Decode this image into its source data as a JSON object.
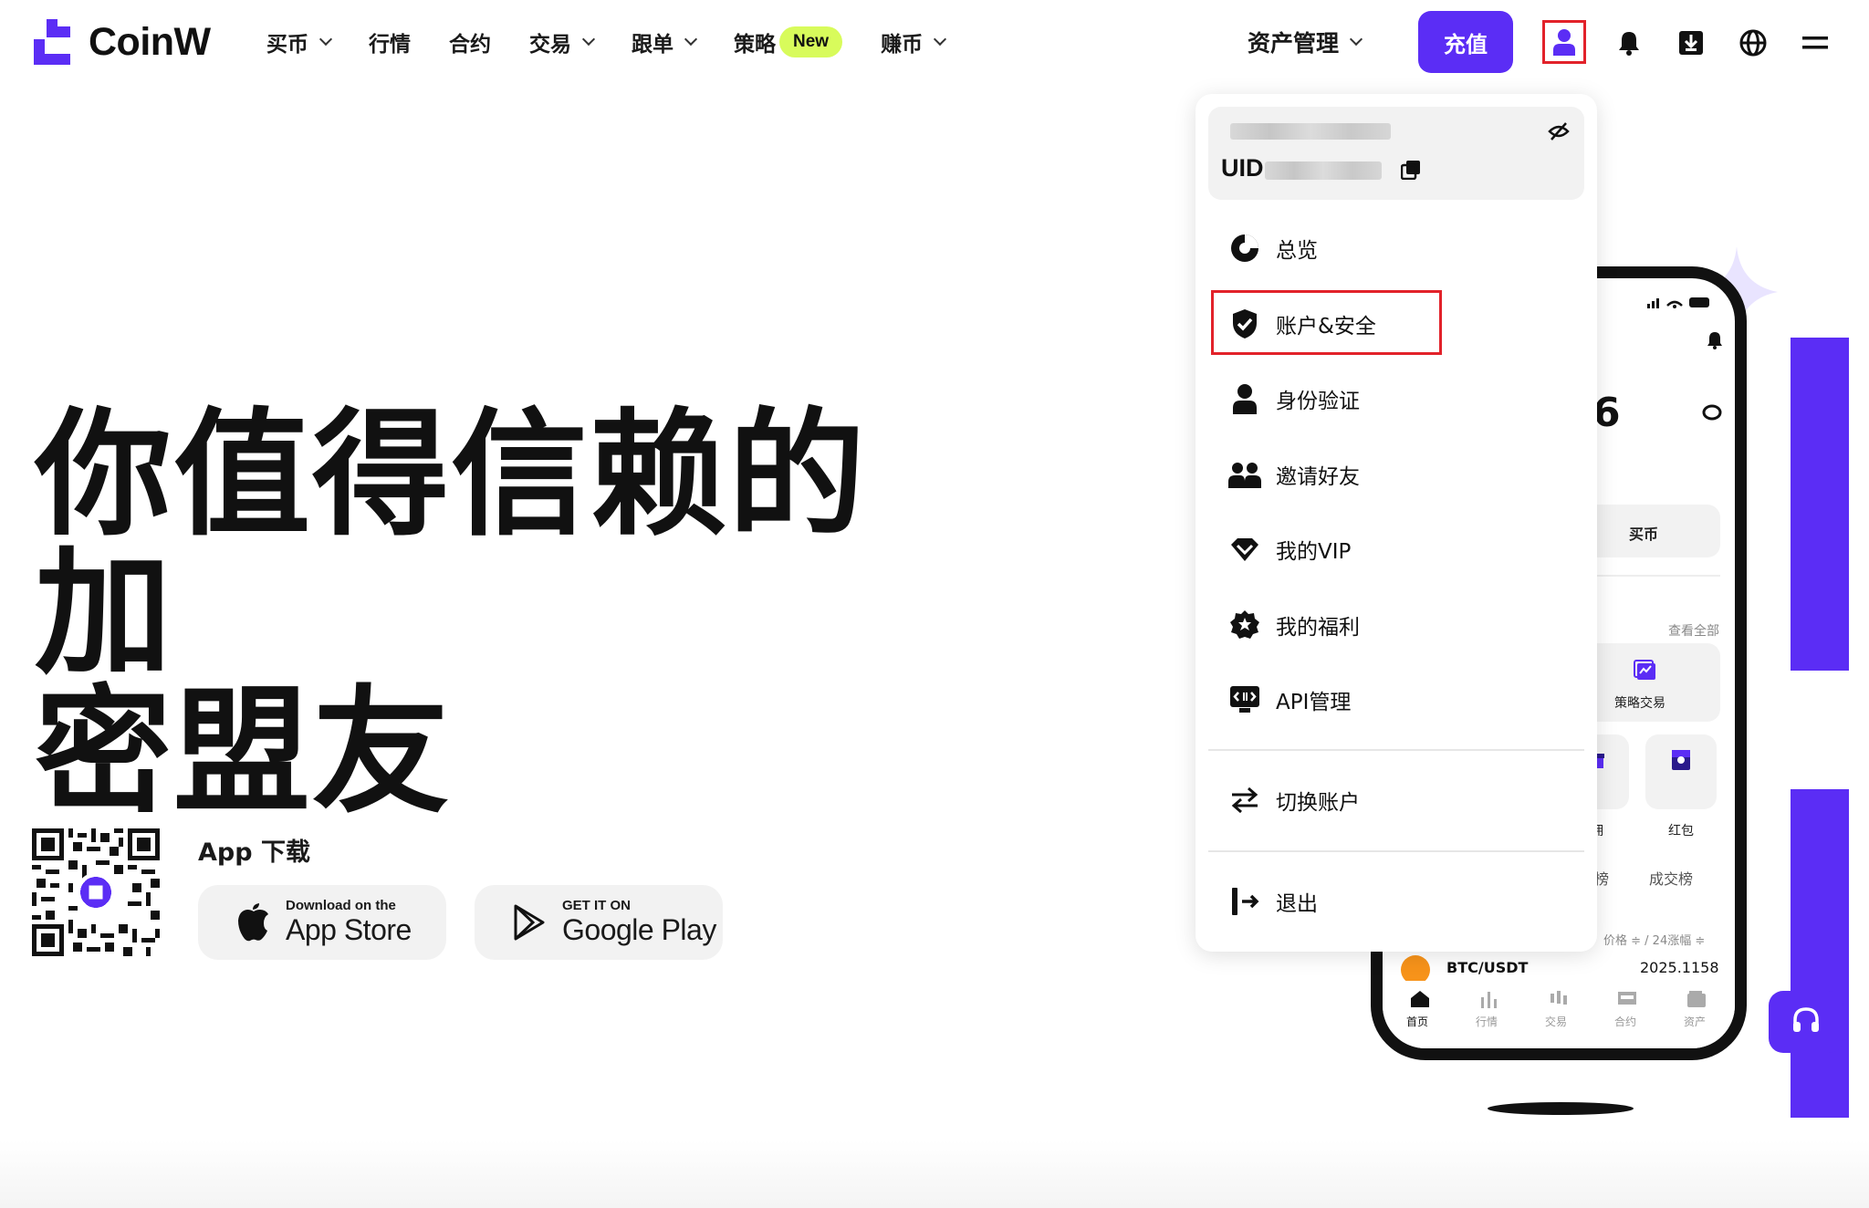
{
  "brand": {
    "name": "CoinW",
    "accent": "#5b2df5",
    "highlight": "#d8fb5b",
    "annotation": "#e2222a"
  },
  "nav": {
    "items": [
      {
        "label": "买币",
        "has_dropdown": true
      },
      {
        "label": "行情",
        "has_dropdown": false
      },
      {
        "label": "合约",
        "has_dropdown": false
      },
      {
        "label": "交易",
        "has_dropdown": true
      },
      {
        "label": "跟单",
        "has_dropdown": true
      },
      {
        "label": "策略",
        "has_dropdown": false,
        "badge": "New"
      },
      {
        "label": "赚币",
        "has_dropdown": true
      }
    ],
    "asset_management": "资产管理",
    "deposit": "充值",
    "icons": [
      "user-icon",
      "bell-icon",
      "download-icon",
      "globe-icon",
      "hamburger-menu-icon"
    ]
  },
  "hero": {
    "title_line1": "你值得信赖的加",
    "title_line2": "密盟友"
  },
  "app_download": {
    "label": "App 下载",
    "app_store_small": "Download on the",
    "app_store_big": "App Store",
    "google_small": "GET IT ON",
    "google_big": "Google Play"
  },
  "user_menu": {
    "uid_label": "UID",
    "items": [
      {
        "label": "总览",
        "icon": "pie-chart-icon"
      },
      {
        "label": "账户&安全",
        "icon": "shield-check-icon",
        "highlighted": true
      },
      {
        "label": "身份验证",
        "icon": "person-icon"
      },
      {
        "label": "邀请好友",
        "icon": "people-icon"
      },
      {
        "label": "我的VIP",
        "icon": "diamond-icon"
      },
      {
        "label": "我的福利",
        "icon": "star-badge-icon"
      },
      {
        "label": "API管理",
        "icon": "api-icon"
      },
      {
        "label": "切换账户",
        "icon": "switch-arrows-icon"
      },
      {
        "label": "退出",
        "icon": "logout-icon"
      }
    ]
  },
  "phone": {
    "balance_digit": "6",
    "buy": "买币",
    "view_all": "查看全部",
    "strategy_trade": "策略交易",
    "invite_rebate": "请返佣",
    "red_packet": "红包",
    "gainers": "涨幅榜",
    "volume": "成交榜",
    "price_header": "价格 ≑ / 24涨幅 ≑",
    "pair": "BTC/USDT",
    "pair_price": "2025.1158",
    "tabs": [
      "首页",
      "行情",
      "交易",
      "合约",
      "资产"
    ]
  }
}
